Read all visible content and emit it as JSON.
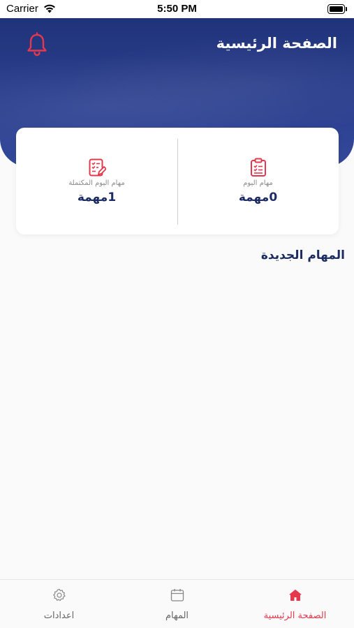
{
  "status_bar": {
    "carrier": "Carrier",
    "time": "5:50 PM"
  },
  "header": {
    "title": "الصفحة الرئيسية",
    "notification_icon": "bell-icon"
  },
  "stats": {
    "today": {
      "label": "مهام اليوم",
      "value": "0مهمة",
      "icon": "clipboard-checklist-icon"
    },
    "completed": {
      "label": "مهام اليوم المكتملة",
      "value": "1مهمة",
      "icon": "checklist-edit-icon"
    }
  },
  "section": {
    "new_tasks_title": "المهام الجديدة"
  },
  "tab_bar": {
    "home": {
      "label": "الصفحة الرئيسية",
      "icon": "home-icon",
      "active": true
    },
    "tasks": {
      "label": "المهام",
      "icon": "calendar-icon",
      "active": false
    },
    "settings": {
      "label": "اعدادات",
      "icon": "gear-icon",
      "active": false
    }
  },
  "colors": {
    "header_bg": "#2b3f8e",
    "accent_red": "#e5384d",
    "text_navy": "#1d2b63",
    "background": "#fafafa"
  }
}
